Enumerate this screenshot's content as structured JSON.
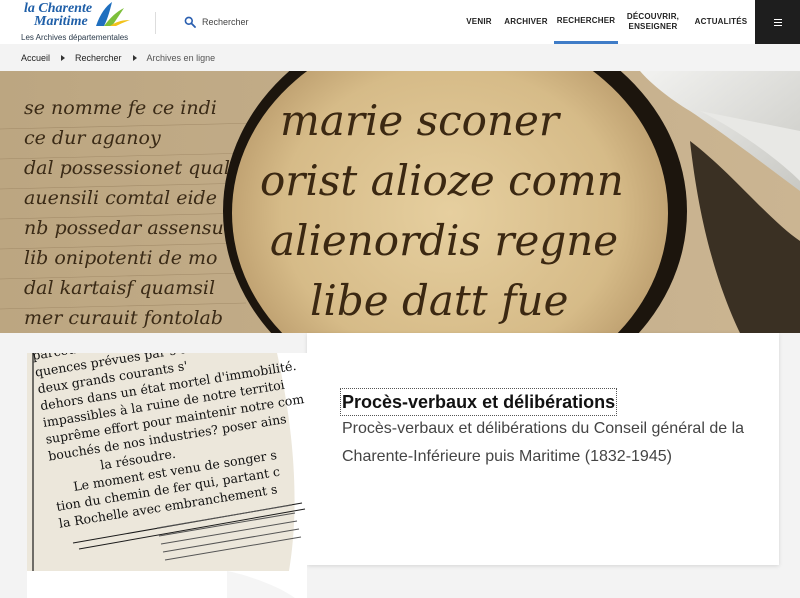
{
  "logo": {
    "line1": "la Charente",
    "line2": "Maritime",
    "subtitle": "Les Archives départementales"
  },
  "search": {
    "placeholder": "Rechercher",
    "icon": "search-icon"
  },
  "nav": {
    "items": [
      {
        "label": "VENIR"
      },
      {
        "label": "ARCHIVER"
      },
      {
        "label": "RECHERCHER",
        "active": true
      },
      {
        "label_line1": "DÉCOUVRIR,",
        "label_line2": "ENSEIGNER"
      },
      {
        "label": "ACTUALITÉS"
      }
    ],
    "menu_icon": "hamburger-icon"
  },
  "breadcrumb": {
    "items": [
      "Accueil",
      "Rechercher",
      "Archives en ligne"
    ]
  },
  "hero": {
    "manuscript_lines": [
      "se nomme fe ce indi",
      "ce dur aganoy",
      "dal possessionet qual",
      "auensili comtal eide",
      "nb possedar assensu",
      "lib onipotenti de mo",
      "dal kartaisf quamsil",
      "mer curauit fontolab"
    ],
    "lens_lines": [
      "marie sconer",
      "orist alioze comn",
      "alienordis regne",
      "libe datt fue"
    ]
  },
  "card": {
    "title": "Procès-verbaux et délibérations",
    "description": "Procès-verbaux et délibérations du Conseil général de la Charente-Inférieure puis Maritime (1832-1945)",
    "thumb_lines": [
      "parcours",
      "quences prévues par  s'établissen",
      "deux  grands  courants  s'",
      "dehors dans un état mortel d'immobilité.",
      "impassibles à la ruine de notre territoi",
      "suprême effort pour maintenir notre com",
      "bouchés de nos  industries? poser ains",
      "la résoudre.",
      "Le moment est venu de songer s",
      "tion du chemin de fer qui, partant c",
      "la Rochelle avec embranchement s"
    ]
  },
  "colors": {
    "logo_blue": "#1f5fa8",
    "active_underline": "#3f7cc7",
    "menu_bg": "#1e1e1e",
    "page_bg": "#f3f3f3"
  }
}
